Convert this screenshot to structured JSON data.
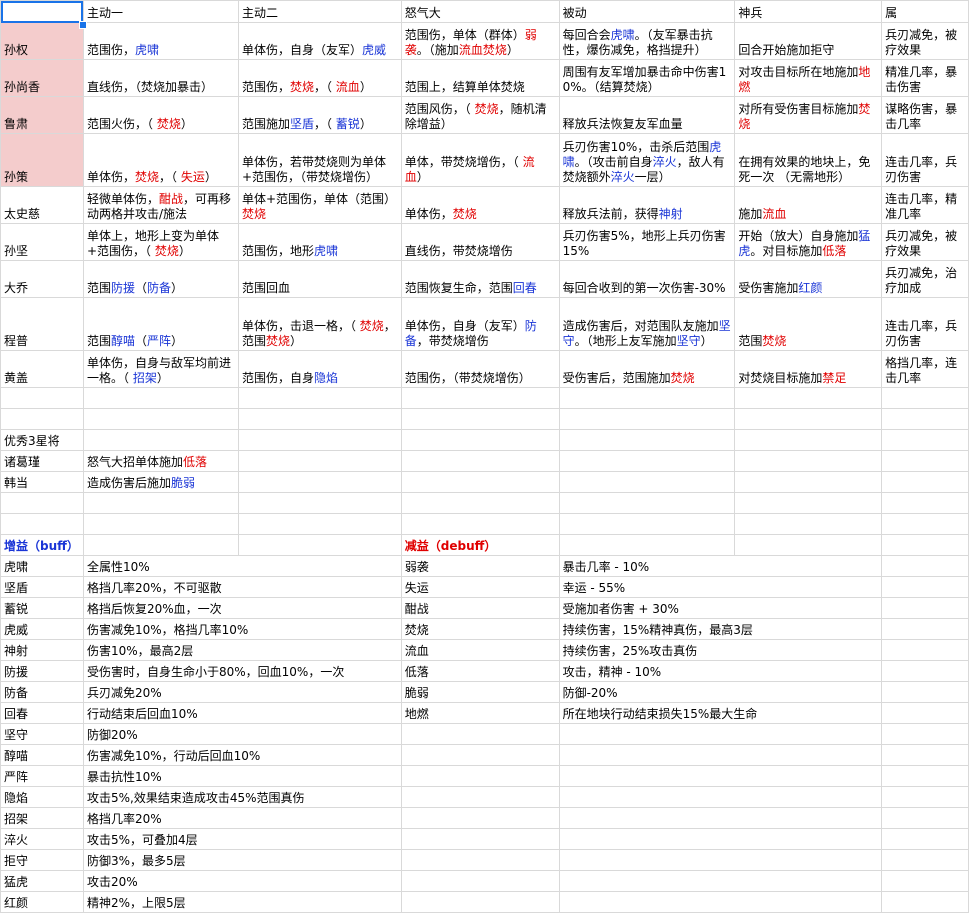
{
  "headers": [
    "",
    "主动一",
    "主动二",
    "怒气大",
    "被动",
    "神兵",
    "属"
  ],
  "heroes": [
    {
      "name": "孙权",
      "pink": true,
      "cells": [
        [
          {
            "t": "范围伤，"
          },
          {
            "t": "虎啸",
            "c": "b"
          }
        ],
        [
          {
            "t": "单体伤，自身（友军）"
          },
          {
            "t": "虎威",
            "c": "b"
          }
        ],
        [
          {
            "t": "范围伤，单体（群体）"
          },
          {
            "t": "弱袭",
            "c": "r"
          },
          {
            "t": "。（施加"
          },
          {
            "t": "流血焚烧",
            "c": "r"
          },
          {
            "t": "）"
          }
        ],
        [
          {
            "t": "每回合会"
          },
          {
            "t": "虎啸",
            "c": "b"
          },
          {
            "t": "。（友军暴击抗性，爆伤减免，格挡提升）"
          }
        ],
        [
          {
            "t": "回合开始施加拒守"
          }
        ],
        [
          {
            "t": "兵刃减免，被疗效果"
          }
        ]
      ]
    },
    {
      "name": "孙尚香",
      "pink": true,
      "cells": [
        [
          {
            "t": "直线伤，（焚烧加暴击）"
          }
        ],
        [
          {
            "t": "范围伤，"
          },
          {
            "t": "焚烧",
            "c": "r"
          },
          {
            "t": "，（ "
          },
          {
            "t": "流血",
            "c": "r"
          },
          {
            "t": "）"
          }
        ],
        [
          {
            "t": "范围上，结算单体焚烧"
          }
        ],
        [
          {
            "t": "周围有友军增加暴击命中伤害10%。（结算焚烧）"
          }
        ],
        [
          {
            "t": "对攻击目标所在地施加"
          },
          {
            "t": "地燃",
            "c": "r"
          }
        ],
        [
          {
            "t": "精准几率，暴击伤害"
          }
        ]
      ]
    },
    {
      "name": "鲁肃",
      "pink": true,
      "cells": [
        [
          {
            "t": "范围火伤，（ "
          },
          {
            "t": "焚烧",
            "c": "r"
          },
          {
            "t": "）"
          }
        ],
        [
          {
            "t": "范围施加"
          },
          {
            "t": "坚盾",
            "c": "b"
          },
          {
            "t": "，（ "
          },
          {
            "t": "蓄锐",
            "c": "b"
          },
          {
            "t": "）"
          }
        ],
        [
          {
            "t": "范围风伤，（ "
          },
          {
            "t": "焚烧",
            "c": "r"
          },
          {
            "t": "，随机清除增益）"
          }
        ],
        [
          {
            "t": "释放兵法恢复友军血量"
          }
        ],
        [
          {
            "t": "对所有受伤害目标施加"
          },
          {
            "t": "焚烧",
            "c": "r"
          }
        ],
        [
          {
            "t": "谋略伤害，暴击几率"
          }
        ]
      ]
    },
    {
      "name": "孙策",
      "pink": true,
      "cells": [
        [
          {
            "t": "单体伤，"
          },
          {
            "t": "焚烧",
            "c": "r"
          },
          {
            "t": "，（ "
          },
          {
            "t": "失运",
            "c": "r"
          },
          {
            "t": "）"
          }
        ],
        [
          {
            "t": "单体伤，若带焚烧则为单体+范围伤，（带焚烧增伤）"
          }
        ],
        [
          {
            "t": "单体，带焚烧增伤，（ "
          },
          {
            "t": "流血",
            "c": "r"
          },
          {
            "t": "）"
          }
        ],
        [
          {
            "t": "兵刃伤害10%，击杀后范围"
          },
          {
            "t": "虎啸",
            "c": "b"
          },
          {
            "t": "。（攻击前自身"
          },
          {
            "t": "淬火",
            "c": "b"
          },
          {
            "t": "，敌人有焚烧额外"
          },
          {
            "t": "淬火",
            "c": "b"
          },
          {
            "t": "一层）"
          }
        ],
        [
          {
            "t": "在拥有效果的地块上，免死一次 （无需地形）"
          }
        ],
        [
          {
            "t": "连击几率，兵刃伤害"
          }
        ]
      ]
    },
    {
      "name": "太史慈",
      "pink": false,
      "cells": [
        [
          {
            "t": "轻微单体伤，"
          },
          {
            "t": "酣战",
            "c": "r"
          },
          {
            "t": "，可再移动两格并攻击/施法"
          }
        ],
        [
          {
            "t": "单体+范围伤，单体（范围）"
          },
          {
            "t": "焚烧",
            "c": "r"
          }
        ],
        [
          {
            "t": "单体伤，"
          },
          {
            "t": "焚烧",
            "c": "r"
          }
        ],
        [
          {
            "t": "释放兵法前，获得"
          },
          {
            "t": "神射",
            "c": "b"
          }
        ],
        [
          {
            "t": "施加"
          },
          {
            "t": "流血",
            "c": "r"
          }
        ],
        [
          {
            "t": "连击几率，精准几率"
          }
        ]
      ]
    },
    {
      "name": "孙坚",
      "pink": false,
      "cells": [
        [
          {
            "t": "单体上，地形上变为单体+范围伤，（ "
          },
          {
            "t": "焚烧",
            "c": "r"
          },
          {
            "t": "）"
          }
        ],
        [
          {
            "t": "范围伤，地形"
          },
          {
            "t": "虎啸",
            "c": "b"
          }
        ],
        [
          {
            "t": "直线伤，带焚烧增伤"
          }
        ],
        [
          {
            "t": "兵刃伤害5%，地形上兵刃伤害15%"
          }
        ],
        [
          {
            "t": "开始（放大）自身施加"
          },
          {
            "t": "猛虎",
            "c": "b"
          },
          {
            "t": "。对目标施加"
          },
          {
            "t": "低落",
            "c": "r"
          }
        ],
        [
          {
            "t": "兵刃减免，被疗效果"
          }
        ]
      ]
    },
    {
      "name": "大乔",
      "pink": false,
      "cells": [
        [
          {
            "t": "范围"
          },
          {
            "t": "防援",
            "c": "b"
          },
          {
            "t": "（"
          },
          {
            "t": "防备",
            "c": "b"
          },
          {
            "t": "）"
          }
        ],
        [
          {
            "t": "范围回血"
          }
        ],
        [
          {
            "t": "范围恢复生命，范围"
          },
          {
            "t": "回春",
            "c": "b"
          }
        ],
        [
          {
            "t": "每回合收到的第一次伤害-30%"
          }
        ],
        [
          {
            "t": "受伤害施加"
          },
          {
            "t": "红颜",
            "c": "b"
          }
        ],
        [
          {
            "t": "兵刃减免，治疗加成"
          }
        ]
      ]
    },
    {
      "name": "程普",
      "pink": false,
      "cells": [
        [
          {
            "t": "范围"
          },
          {
            "t": "醇喵",
            "c": "b"
          },
          {
            "t": "（"
          },
          {
            "t": "严阵",
            "c": "b"
          },
          {
            "t": "）"
          }
        ],
        [
          {
            "t": "单体伤，击退一格，（ "
          },
          {
            "t": "焚烧",
            "c": "r"
          },
          {
            "t": "，范围"
          },
          {
            "t": "焚烧",
            "c": "r"
          },
          {
            "t": "）"
          }
        ],
        [
          {
            "t": "单体伤，自身（友军）"
          },
          {
            "t": "防备",
            "c": "b"
          },
          {
            "t": "，带焚烧增伤"
          }
        ],
        [
          {
            "t": "造成伤害后，对范围队友施加"
          },
          {
            "t": "坚守",
            "c": "b"
          },
          {
            "t": "。（地形上友军施加"
          },
          {
            "t": "坚守",
            "c": "b"
          },
          {
            "t": "）"
          }
        ],
        [
          {
            "t": "范围"
          },
          {
            "t": "焚烧",
            "c": "r"
          }
        ],
        [
          {
            "t": "连击几率，兵刃伤害"
          }
        ]
      ]
    },
    {
      "name": "黄盖",
      "pink": false,
      "cells": [
        [
          {
            "t": "单体伤，自身与敌军均前进一格。（ "
          },
          {
            "t": "招架",
            "c": "b"
          },
          {
            "t": "）"
          }
        ],
        [
          {
            "t": "范围伤，自身"
          },
          {
            "t": "隐焰",
            "c": "b"
          }
        ],
        [
          {
            "t": "范围伤，（带焚烧增伤）"
          }
        ],
        [
          {
            "t": "受伤害后，范围施加"
          },
          {
            "t": "焚烧",
            "c": "r"
          }
        ],
        [
          {
            "t": "对焚烧目标施加"
          },
          {
            "t": "禁足",
            "c": "r"
          }
        ],
        [
          {
            "t": "格挡几率，连击几率"
          }
        ]
      ]
    }
  ],
  "three_star": {
    "title": "优秀3星将",
    "rows": [
      {
        "name": "诸葛瑾",
        "desc": [
          {
            "t": "怒气大招单体施加"
          },
          {
            "t": "低落",
            "c": "r"
          }
        ]
      },
      {
        "name": "韩当",
        "desc": [
          {
            "t": "造成伤害后施加"
          },
          {
            "t": "脆弱",
            "c": "b"
          }
        ]
      }
    ]
  },
  "buff_title": "增益（buff）",
  "debuff_title": "减益（debuff）",
  "buffs": [
    {
      "name": "虎啸",
      "desc": "全属性10%"
    },
    {
      "name": "坚盾",
      "desc": "格挡几率20%，不可驱散"
    },
    {
      "name": "蓄锐",
      "desc": "格挡后恢复20%血，一次"
    },
    {
      "name": "虎威",
      "desc": "伤害减免10%，格挡几率10%"
    },
    {
      "name": "神射",
      "desc": "伤害10%，最高2层"
    },
    {
      "name": "防援",
      "desc": "受伤害时，自身生命小于80%，回血10%，一次"
    },
    {
      "name": "防备",
      "desc": "兵刃减免20%"
    },
    {
      "name": "回春",
      "desc": "行动结束后回血10%"
    },
    {
      "name": "坚守",
      "desc": "防御20%"
    },
    {
      "name": "醇喵",
      "desc": "伤害减免10%，行动后回血10%"
    },
    {
      "name": "严阵",
      "desc": "暴击抗性10%"
    },
    {
      "name": "隐焰",
      "desc": "攻击5%,效果结束造成攻击45%范围真伤"
    },
    {
      "name": "招架",
      "desc": "格挡几率20%"
    },
    {
      "name": "淬火",
      "desc": "攻击5%，可叠加4层"
    },
    {
      "name": "拒守",
      "desc": "防御3%，最多5层"
    },
    {
      "name": "猛虎",
      "desc": "攻击20%"
    },
    {
      "name": "红颜",
      "desc": "精神2%，上限5层"
    }
  ],
  "debuffs": [
    {
      "name": "弱袭",
      "desc": "暴击几率 - 10%"
    },
    {
      "name": "失运",
      "desc": "幸运 - 55%"
    },
    {
      "name": "酣战",
      "desc": "受施加者伤害 + 30%"
    },
    {
      "name": "焚烧",
      "desc": "持续伤害，15%精神真伤，最高3层"
    },
    {
      "name": "流血",
      "desc": "持续伤害，25%攻击真伤"
    },
    {
      "name": "低落",
      "desc": "攻击，精神 - 10%"
    },
    {
      "name": "脆弱",
      "desc": "防御-20%"
    },
    {
      "name": "地燃",
      "desc": "所在地块行动结束损失15%最大生命"
    }
  ]
}
